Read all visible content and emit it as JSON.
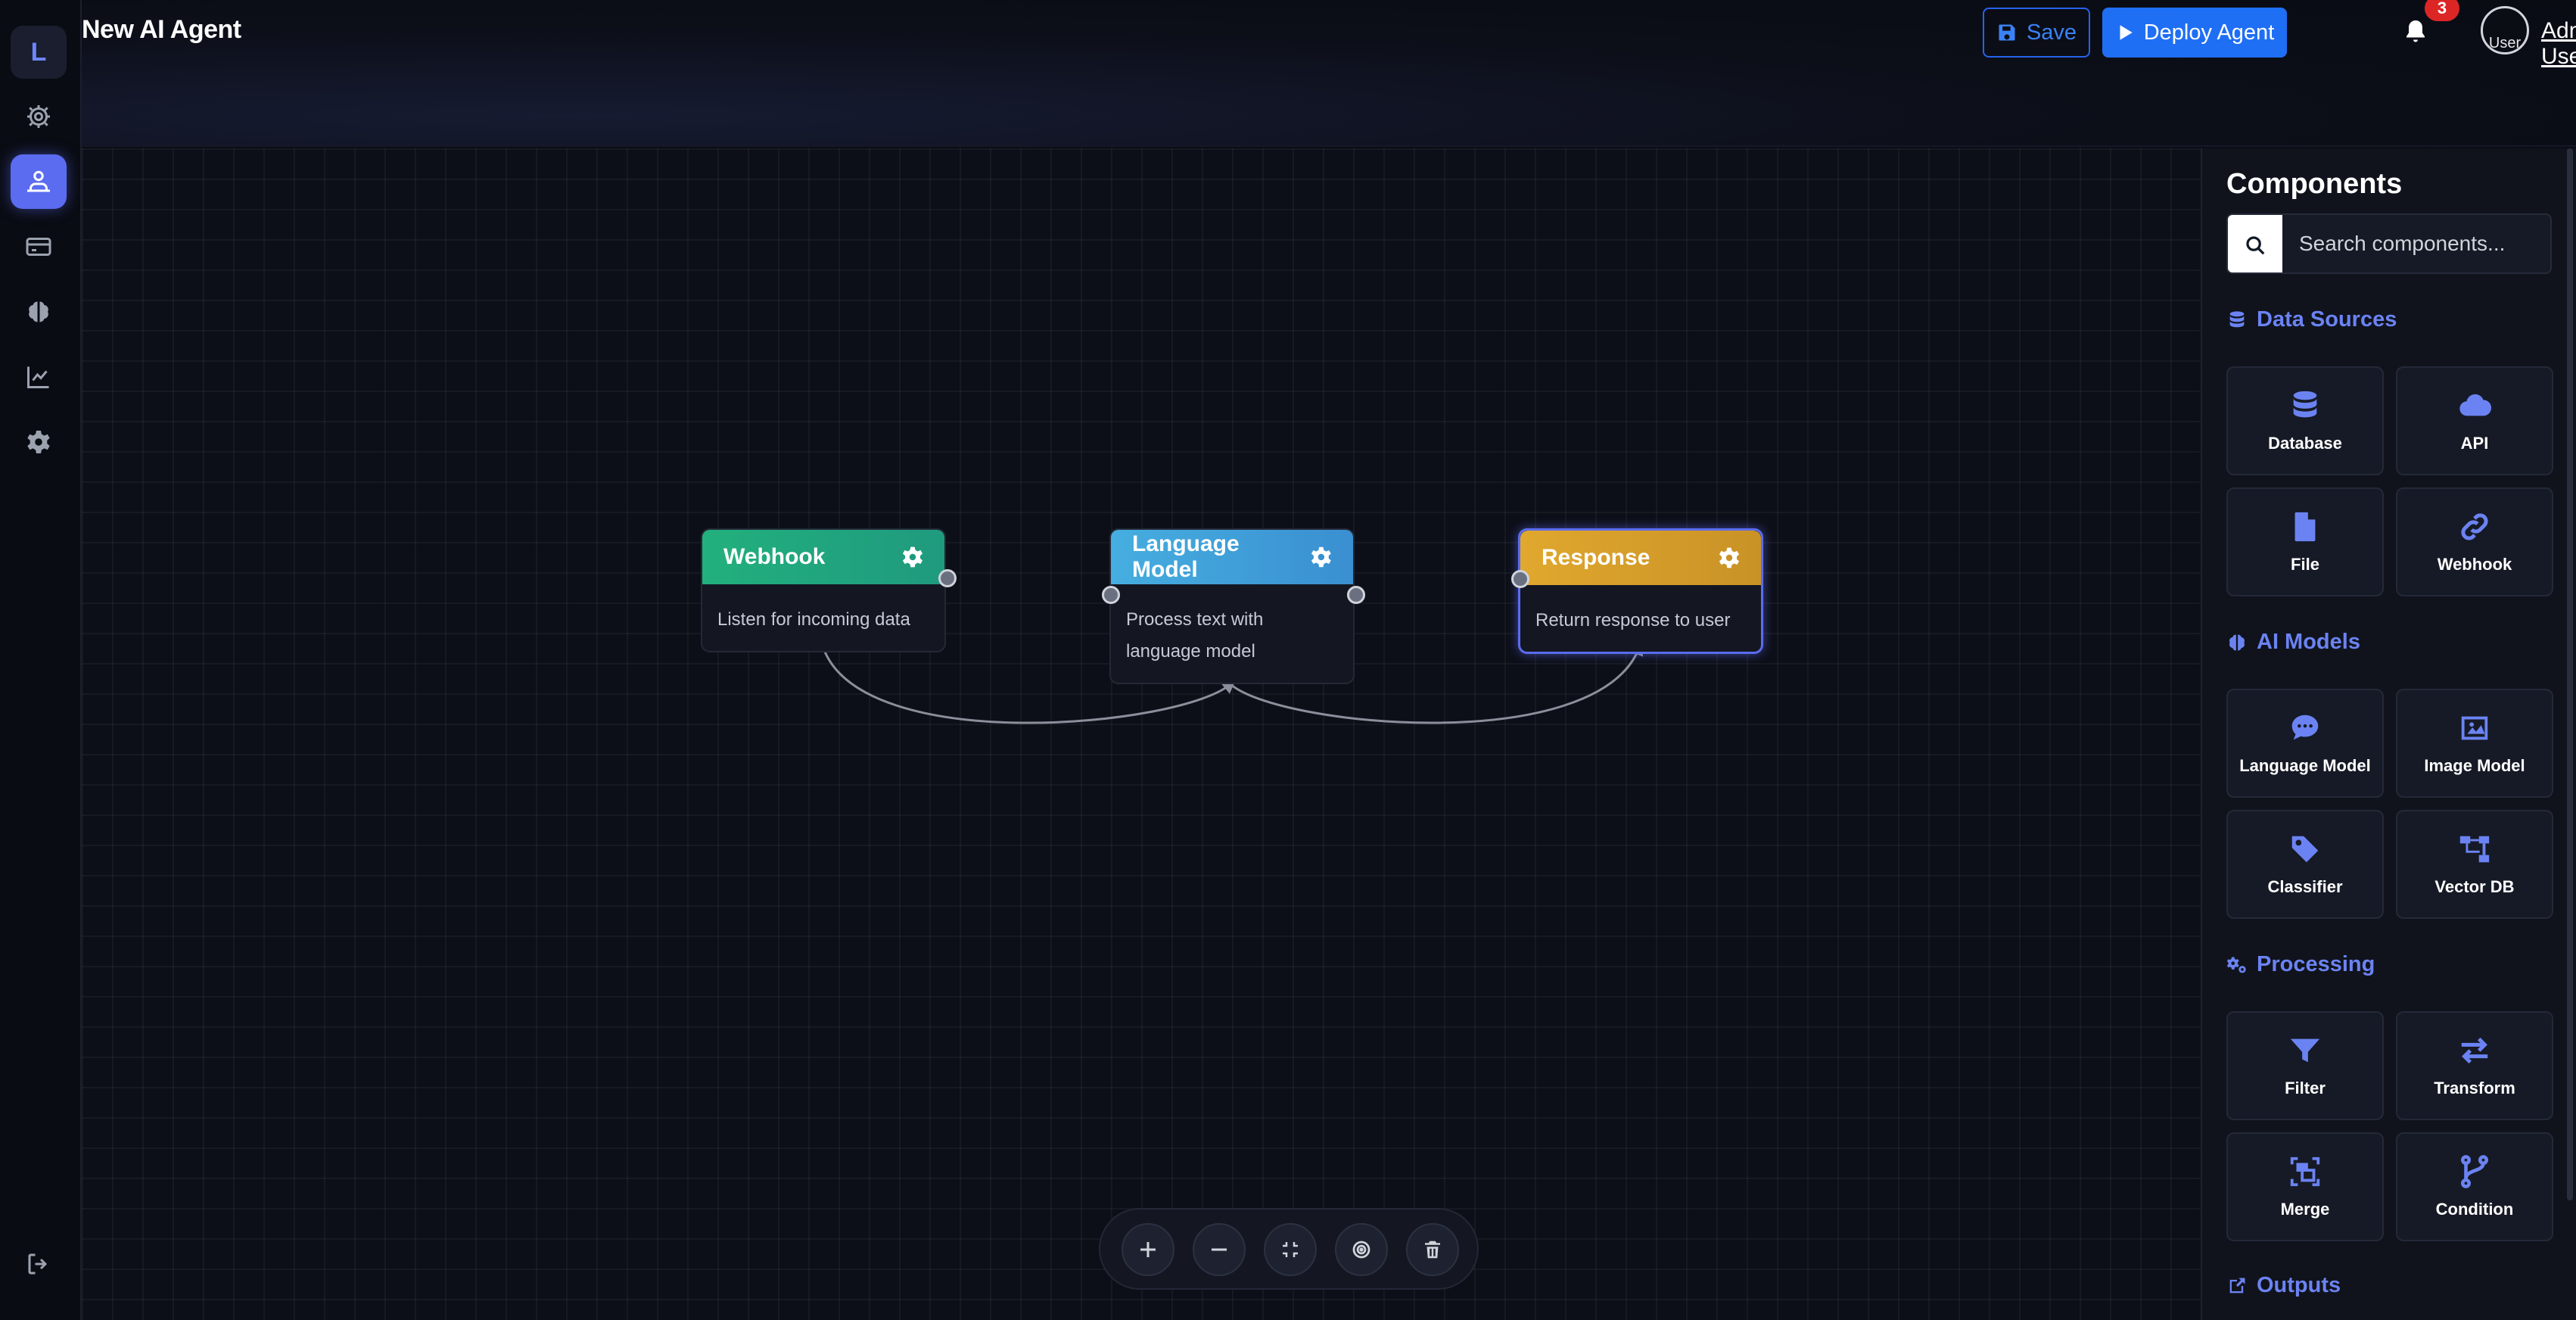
{
  "colors": {
    "accent": "#5b6cf0",
    "primary_button": "#1f6ff5",
    "section_title": "#6b83f2",
    "webhook_header": "#22b07d",
    "language_model_header": "#3fa6dc",
    "response_header": "#e0a82e",
    "badge": "#dc2626"
  },
  "sidebar": {
    "logo": "L",
    "items": [
      {
        "icon": "gear-outline-icon"
      },
      {
        "icon": "agent-network-icon",
        "active": true
      },
      {
        "icon": "credit-card-icon"
      },
      {
        "icon": "brain-icon"
      },
      {
        "icon": "chart-line-icon"
      },
      {
        "icon": "cog-icon"
      },
      {
        "icon": "logout-icon"
      }
    ]
  },
  "header": {
    "title": "New AI Agent",
    "save_label": "Save",
    "deploy_label": "Deploy Agent",
    "notification_count": "3",
    "avatar_alt": "User",
    "username": "Admin User"
  },
  "canvas": {
    "nodes": [
      {
        "title": "Webhook",
        "description": "Listen for incoming data",
        "selected": false
      },
      {
        "title": "Language Model",
        "description": "Process text with language model",
        "selected": false
      },
      {
        "title": "Response",
        "description": "Return response to user",
        "selected": true
      }
    ],
    "connections": [
      {
        "from": "Webhook",
        "to": "Language Model"
      },
      {
        "from": "Language Model",
        "to": "Response"
      }
    ],
    "toolbar": [
      {
        "icon": "zoom-in-icon"
      },
      {
        "icon": "zoom-out-icon"
      },
      {
        "icon": "fit-view-icon"
      },
      {
        "icon": "center-icon"
      },
      {
        "icon": "trash-icon"
      }
    ]
  },
  "panel": {
    "title": "Components",
    "search_placeholder": "Search components...",
    "sections": [
      {
        "title": "Data Sources",
        "icon": "database-stack-icon",
        "items": [
          {
            "label": "Database",
            "icon": "database-icon"
          },
          {
            "label": "API",
            "icon": "cloud-icon"
          },
          {
            "label": "File",
            "icon": "file-icon"
          },
          {
            "label": "Webhook",
            "icon": "link-icon"
          }
        ]
      },
      {
        "title": "AI Models",
        "icon": "brain-icon",
        "items": [
          {
            "label": "Language Model",
            "icon": "chat-bubble-icon"
          },
          {
            "label": "Image Model",
            "icon": "image-icon"
          },
          {
            "label": "Classifier",
            "icon": "tag-icon"
          },
          {
            "label": "Vector DB",
            "icon": "sitemap-icon"
          }
        ]
      },
      {
        "title": "Processing",
        "icon": "cogs-icon",
        "items": [
          {
            "label": "Filter",
            "icon": "funnel-icon"
          },
          {
            "label": "Transform",
            "icon": "arrows-exchange-icon"
          },
          {
            "label": "Merge",
            "icon": "merge-box-icon"
          },
          {
            "label": "Condition",
            "icon": "branch-icon"
          }
        ]
      },
      {
        "title": "Outputs",
        "icon": "share-box-icon",
        "items": []
      }
    ]
  }
}
